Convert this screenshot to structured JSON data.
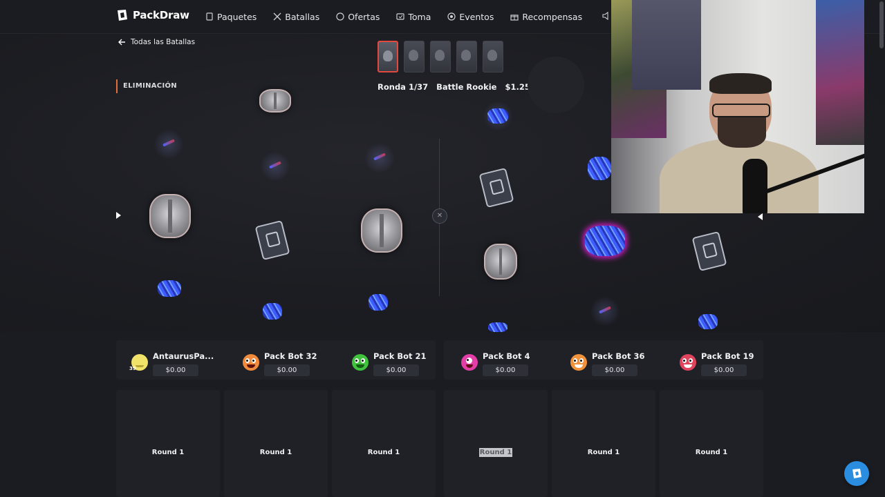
{
  "brand": {
    "name": "PackDraw"
  },
  "nav": {
    "items": [
      {
        "label": "Paquetes",
        "icon": "box-icon"
      },
      {
        "label": "Batallas",
        "icon": "swords-icon"
      },
      {
        "label": "Ofertas",
        "icon": "offers-icon"
      },
      {
        "label": "Toma",
        "icon": "draw-icon"
      },
      {
        "label": "Eventos",
        "icon": "events-icon"
      },
      {
        "label": "Recompensas",
        "icon": "gift-icon"
      }
    ]
  },
  "battle": {
    "back_label": "Todas las Batallas",
    "mode": "ELIMINACIÓN",
    "round": "Ronda 1/37",
    "pack_name": "Battle Rookie",
    "price": "$1.25"
  },
  "players": [
    {
      "name": "AntaurusPa...",
      "balance": "$0.00",
      "level": "39",
      "color": "#f1e36a"
    },
    {
      "name": "Pack Bot 32",
      "balance": "$0.00",
      "color": "#f08a3c"
    },
    {
      "name": "Pack Bot 21",
      "balance": "$0.00",
      "color": "#3fc23c"
    },
    {
      "name": "Pack Bot 4",
      "balance": "$0.00",
      "color": "#e33ea8"
    },
    {
      "name": "Pack Bot 36",
      "balance": "$0.00",
      "color": "#f0923c"
    },
    {
      "name": "Pack Bot 19",
      "balance": "$0.00",
      "color": "#e0435c"
    }
  ],
  "rounds": [
    "Round 1",
    "Round 1",
    "Round 1",
    "Round 1",
    "Round 1",
    "Round 1"
  ],
  "colors": {
    "accent": "#e0703a",
    "active_thumb": "#e3493c",
    "chat": "#2b8de0"
  }
}
